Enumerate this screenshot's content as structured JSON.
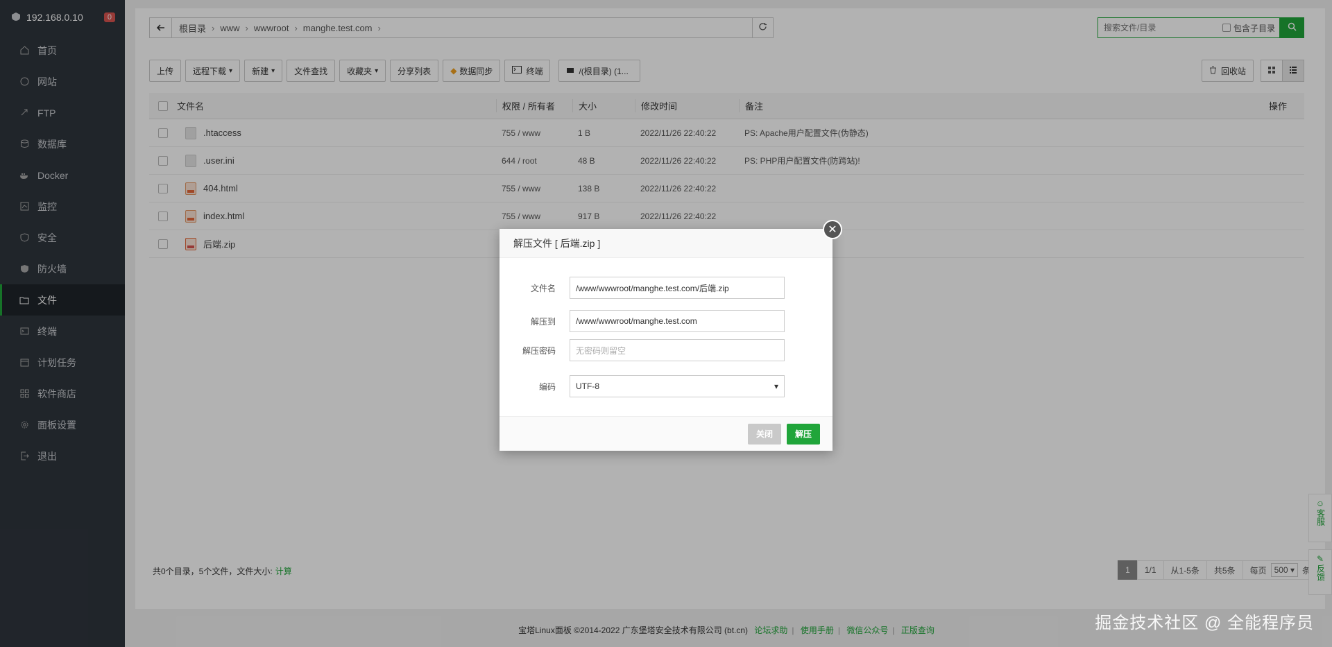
{
  "sidebar": {
    "ip": "192.168.0.10",
    "badge": "0",
    "items": [
      {
        "label": "首页"
      },
      {
        "label": "网站"
      },
      {
        "label": "FTP"
      },
      {
        "label": "数据库"
      },
      {
        "label": "Docker"
      },
      {
        "label": "监控"
      },
      {
        "label": "安全"
      },
      {
        "label": "防火墙"
      },
      {
        "label": "文件"
      },
      {
        "label": "终端"
      },
      {
        "label": "计划任务"
      },
      {
        "label": "软件商店"
      },
      {
        "label": "面板设置"
      },
      {
        "label": "退出"
      }
    ],
    "active": "文件"
  },
  "path": {
    "crumbs": [
      "根目录",
      "www",
      "wwwroot",
      "manghe.test.com"
    ]
  },
  "search": {
    "placeholder": "搜索文件/目录",
    "include_sub": "包含子目录"
  },
  "toolbar": {
    "upload": "上传",
    "remote_download": "远程下载",
    "new": "新建",
    "file_search": "文件查找",
    "favorites": "收藏夹",
    "share_list": "分享列表",
    "data_sync": "数据同步",
    "terminal": "终端",
    "disk": "/(根目录) (1...",
    "recycle": "回收站"
  },
  "table": {
    "headers": {
      "name": "文件名",
      "perm": "权限 / 所有者",
      "size": "大小",
      "time": "修改时间",
      "note": "备注",
      "op": "操作"
    },
    "rows": [
      {
        "name": ".htaccess",
        "perm": "755 / www",
        "size": "1 B",
        "time": "2022/11/26 22:40:22",
        "note": "PS: Apache用户配置文件(伪静态)"
      },
      {
        "name": ".user.ini",
        "perm": "644 / root",
        "size": "48 B",
        "time": "2022/11/26 22:40:22",
        "note": "PS: PHP用户配置文件(防跨站)!"
      },
      {
        "name": "404.html",
        "perm": "755 / www",
        "size": "138 B",
        "time": "2022/11/26 22:40:22",
        "note": ""
      },
      {
        "name": "index.html",
        "perm": "755 / www",
        "size": "917 B",
        "time": "2022/11/26 22:40:22",
        "note": ""
      },
      {
        "name": "后端.zip",
        "perm": "",
        "size": "",
        "time": "",
        "note": ""
      }
    ]
  },
  "footer": {
    "summary": "共0个目录，5个文件，文件大小:",
    "calc": "计算",
    "pager": {
      "current": "1",
      "total": "1/1",
      "range": "从1-5条",
      "count": "共5条",
      "per_page_label": "每页",
      "per_page": "500",
      "unit": "条"
    }
  },
  "copyright": {
    "text": "宝塔Linux面板 ©2014-2022 广东堡塔安全技术有限公司 (bt.cn)",
    "links": [
      "论坛求助",
      "使用手册",
      "微信公众号",
      "正版查询"
    ]
  },
  "float": {
    "service": "客服",
    "feedback": "反馈"
  },
  "watermark": "掘金技术社区 @ 全能程序员",
  "modal": {
    "title": "解压文件 [ 后端.zip ]",
    "filename_label": "文件名",
    "filename_value": "/www/wwwroot/manghe.test.com/后端.zip",
    "dest_label": "解压到",
    "dest_value": "/www/wwwroot/manghe.test.com",
    "password_label": "解压密码",
    "password_placeholder": "无密码则留空",
    "encoding_label": "编码",
    "encoding_value": "UTF-8",
    "close_btn": "关闭",
    "extract_btn": "解压"
  }
}
